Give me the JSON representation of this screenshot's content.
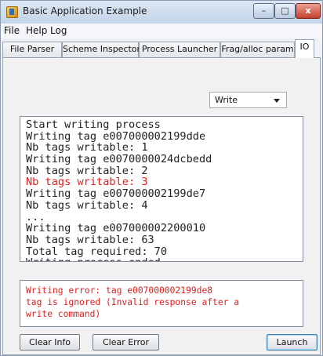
{
  "window": {
    "title": "Basic Application Example",
    "controls": {
      "minimize": "–",
      "maximize": "□",
      "close": "x"
    }
  },
  "menu": {
    "items": [
      "File",
      "Help",
      "Log"
    ]
  },
  "tabs": [
    {
      "label": "File Parser"
    },
    {
      "label": "Scheme Inspector"
    },
    {
      "label": "Process Launcher"
    },
    {
      "label": "Frag/alloc param"
    },
    {
      "label": "IO"
    }
  ],
  "active_tab": "IO",
  "mode_select": {
    "value": "Write"
  },
  "log": {
    "lines": [
      {
        "text": "Start writing process",
        "error": false
      },
      {
        "text": "Writing tag e007000002199dde",
        "error": false
      },
      {
        "text": "Nb tags writable: 1",
        "error": false
      },
      {
        "text": "Writing tag e0070000024dcbedd",
        "error": false
      },
      {
        "text": "Nb tags writable: 2",
        "error": false
      },
      {
        "text": "Nb tags writable: 3",
        "error": true
      },
      {
        "text": "Writing tag e007000002199de7",
        "error": false
      },
      {
        "text": "Nb tags writable: 4",
        "error": false
      },
      {
        "text": "...",
        "error": false
      },
      {
        "text": "Writing tag e007000002200010",
        "error": false
      },
      {
        "text": "Nb tags writable: 63",
        "error": false
      },
      {
        "text": "Total tag required: 70",
        "error": false
      },
      {
        "text": "Writing process ended",
        "error": false
      }
    ]
  },
  "error_box": {
    "lines": [
      "Writing error: tag e007000002199de8",
      "tag is ignored (Invalid response after a",
      "write command)"
    ]
  },
  "buttons": {
    "clear_info": "Clear Info",
    "clear_error": "Clear Error",
    "launch": "Launch"
  }
}
